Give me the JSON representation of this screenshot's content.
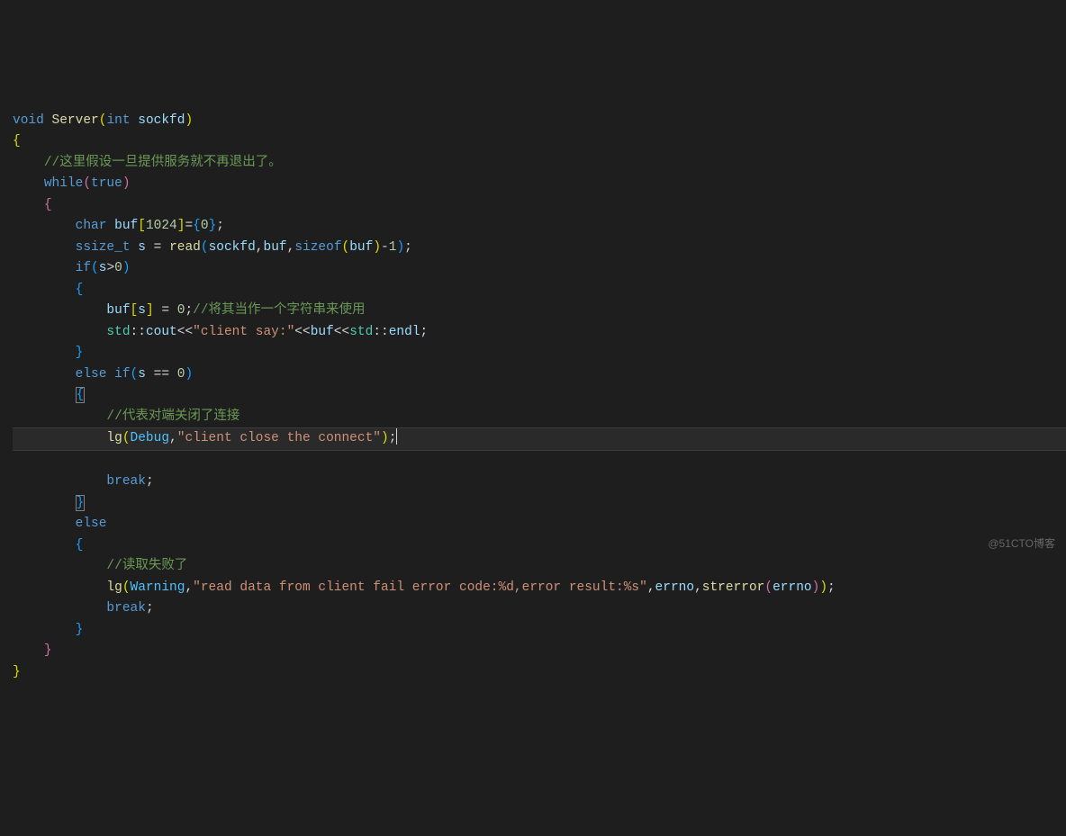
{
  "code": {
    "line1": {
      "void": "void",
      "server": "Server",
      "int": "int",
      "sockfd": "sockfd"
    },
    "line3_comment": "//这里假设一旦提供服务就不再退出了。",
    "line4": {
      "while": "while",
      "true": "true"
    },
    "line6": {
      "char": "char",
      "buf": "buf",
      "size": "1024",
      "zero": "0"
    },
    "line7": {
      "ssize_t": "ssize_t",
      "s": "s",
      "read": "read",
      "sockfd": "sockfd",
      "buf": "buf",
      "sizeof": "sizeof",
      "buf2": "buf",
      "one": "1"
    },
    "line8": {
      "if": "if",
      "s": "s",
      "zero": "0"
    },
    "line10": {
      "buf": "buf",
      "s": "s",
      "zero": "0",
      "comment": "//将其当作一个字符串来使用"
    },
    "line11": {
      "std": "std",
      "cout": "cout",
      "str": "\"client say:\"",
      "buf": "buf",
      "std2": "std",
      "endl": "endl"
    },
    "line13": {
      "else": "else",
      "if": "if",
      "s": "s",
      "zero": "0"
    },
    "line15_comment": "//代表对端关闭了连接",
    "line16": {
      "lg": "lg",
      "debug": "Debug",
      "str": "\"client close the connect\""
    },
    "line17_break": "break",
    "line19_else": "else",
    "line21_comment": "//读取失败了",
    "line22": {
      "lg": "lg",
      "warning": "Warning",
      "str": "\"read data from client fail error code:%d,error result:%s\"",
      "errno": "errno",
      "strerror": "strerror",
      "errno2": "errno"
    },
    "line23_break": "break"
  },
  "watermark": "@51CTO博客"
}
